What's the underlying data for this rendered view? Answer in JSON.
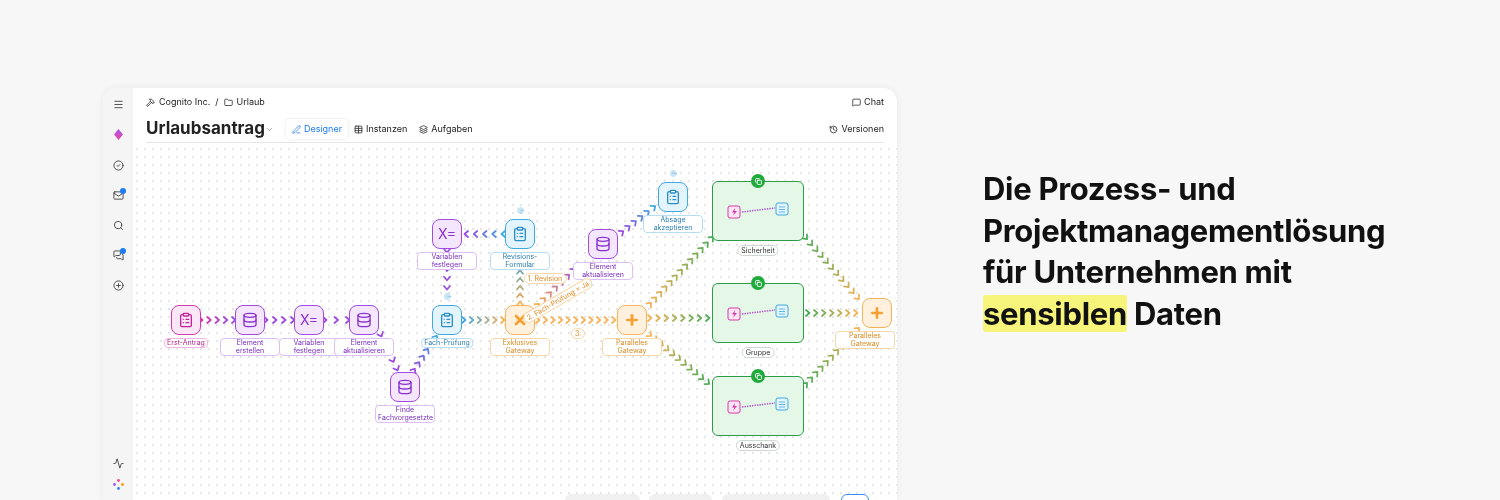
{
  "breadcrumb": {
    "workspace": "Cognito Inc.",
    "separator": "/",
    "folder": "Urlaub"
  },
  "chat": "Chat",
  "title": "Urlaubsantrag",
  "tabs": [
    {
      "label": "Designer",
      "selected": true
    },
    {
      "label": "Instanzen",
      "selected": false
    },
    {
      "label": "Aufgaben",
      "selected": false
    }
  ],
  "versions": "Versionen",
  "nodes": [
    {
      "label": "Absage akzeptieren",
      "kind": "form"
    },
    {
      "label": "Variablen festlegen",
      "kind": "variables",
      "symbol": "X="
    },
    {
      "label": "Revisions-Formular",
      "kind": "form"
    },
    {
      "label": "Element aktualisieren",
      "kind": "update"
    },
    {
      "label": "Erst-Antrag",
      "kind": "start"
    },
    {
      "label": "Element erstellen",
      "kind": "create"
    },
    {
      "label": "Variablen festlegen",
      "kind": "variables",
      "symbol": "X="
    },
    {
      "label": "Element aktualisieren",
      "kind": "update"
    },
    {
      "label": "Fach-Prüfung",
      "kind": "form"
    },
    {
      "label": "Exklusives Gateway",
      "kind": "exclusive"
    },
    {
      "label": "Paralleles Gateway",
      "kind": "parallel"
    },
    {
      "label": "Paralleles Gateway",
      "kind": "parallel"
    },
    {
      "label": "Finde Fachvorgesetzte",
      "kind": "find"
    }
  ],
  "groups": [
    {
      "label": "Sicherheit"
    },
    {
      "label": "Gruppe"
    },
    {
      "label": "Ausschank"
    }
  ],
  "edge_labels": [
    {
      "text": "1. Revision",
      "kind": "flat"
    },
    {
      "text": "2. Fach-Prüfung = Ja",
      "kind": "slanted"
    },
    {
      "text": "3.",
      "kind": "flat"
    }
  ],
  "headline": {
    "lines": [
      [
        {
          "text": "Die Prozess- und",
          "highlight": false
        }
      ],
      [
        {
          "text": "Projektmanagementlösung",
          "highlight": false
        }
      ],
      [
        {
          "text": "für Unternehmen mit",
          "highlight": false
        }
      ],
      [
        {
          "text": "sensiblen",
          "highlight": true
        },
        {
          "text": " Daten",
          "highlight": false
        }
      ]
    ]
  }
}
